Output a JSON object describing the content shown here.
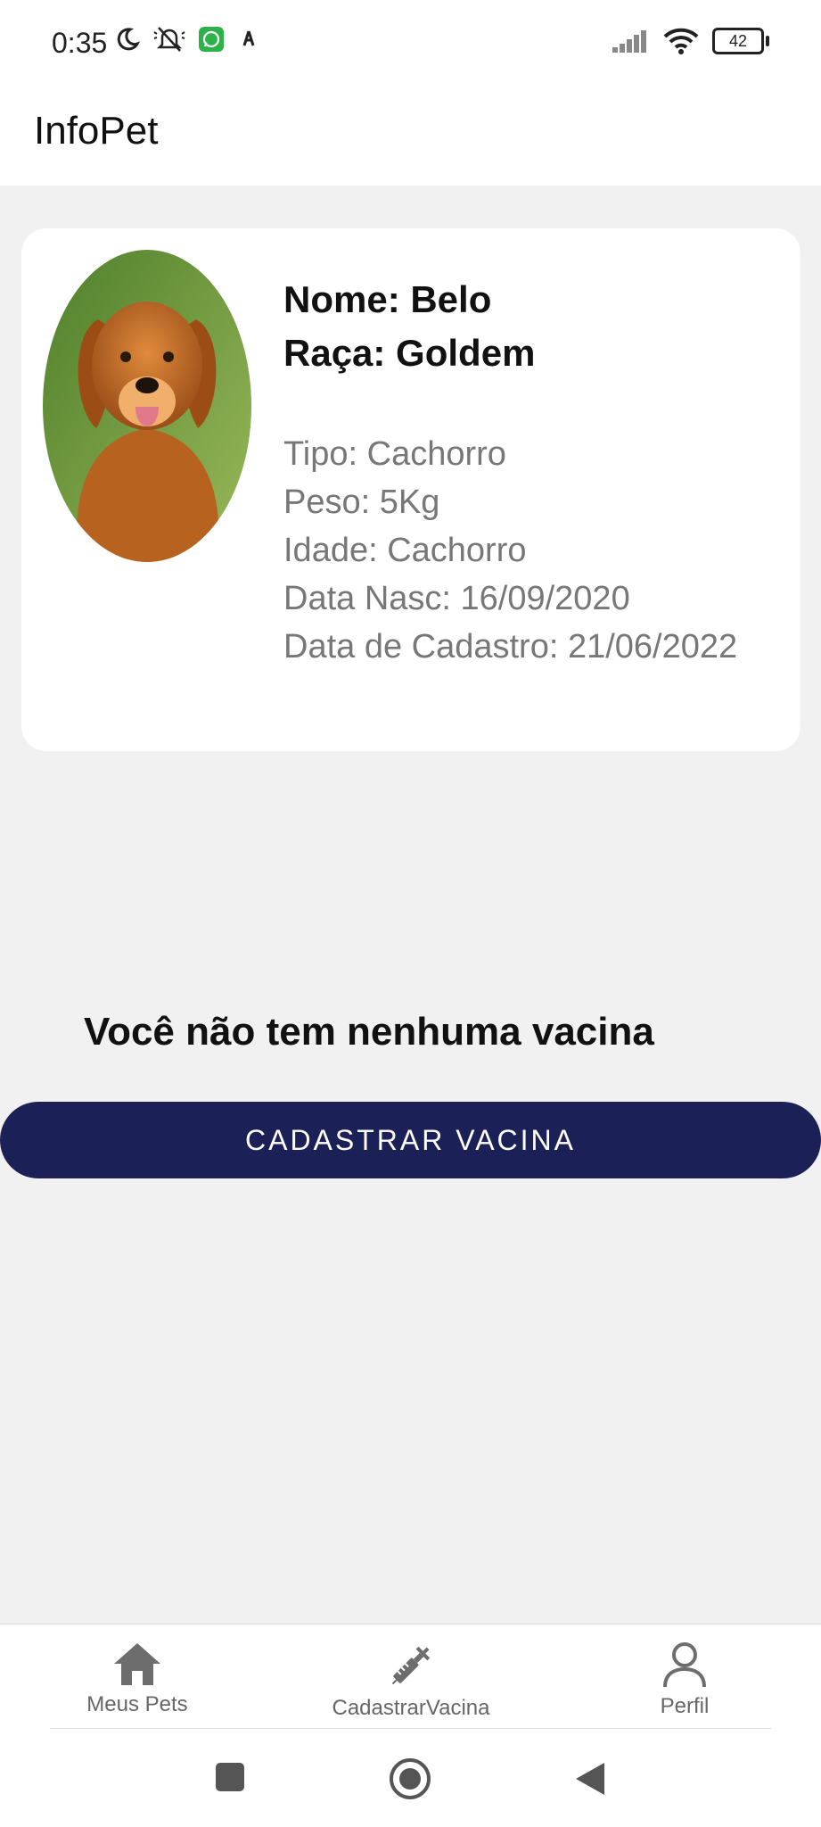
{
  "status_bar": {
    "time": "0:35",
    "battery": "42",
    "icons_left": [
      "moon-icon",
      "bell-off-icon",
      "whatsapp-icon",
      "notification-icon"
    ],
    "icons_right": [
      "signal-icon",
      "wifi-icon",
      "battery-icon"
    ]
  },
  "app": {
    "title": "InfoPet"
  },
  "pet": {
    "name": "Nome: Belo",
    "breed": "Raça: Goldem",
    "type": "Tipo: Cachorro",
    "weight": "Peso: 5Kg",
    "age": "Idade: Cachorro",
    "birth_date": "Data Nasc: 16/09/2020",
    "register_date": "Data de Cadastro: 21/06/2022"
  },
  "vaccines": {
    "empty_message": "Você não tem nenhuma vacina",
    "add_button_label": "CADASTRAR VACINA"
  },
  "bottom_nav": {
    "items": [
      {
        "label": "Meus Pets",
        "icon": "home-icon"
      },
      {
        "label": "CadastrarVacina",
        "icon": "syringe-icon"
      },
      {
        "label": "Perfil",
        "icon": "person-icon"
      }
    ]
  },
  "system_nav": [
    "recents-icon",
    "home-circle-icon",
    "back-icon"
  ],
  "colors": {
    "primary_button": "#1b2157",
    "background": "#f1f1f1",
    "card": "#ffffff",
    "detail_text": "#777777",
    "nav_icon": "#6d6d6d"
  }
}
